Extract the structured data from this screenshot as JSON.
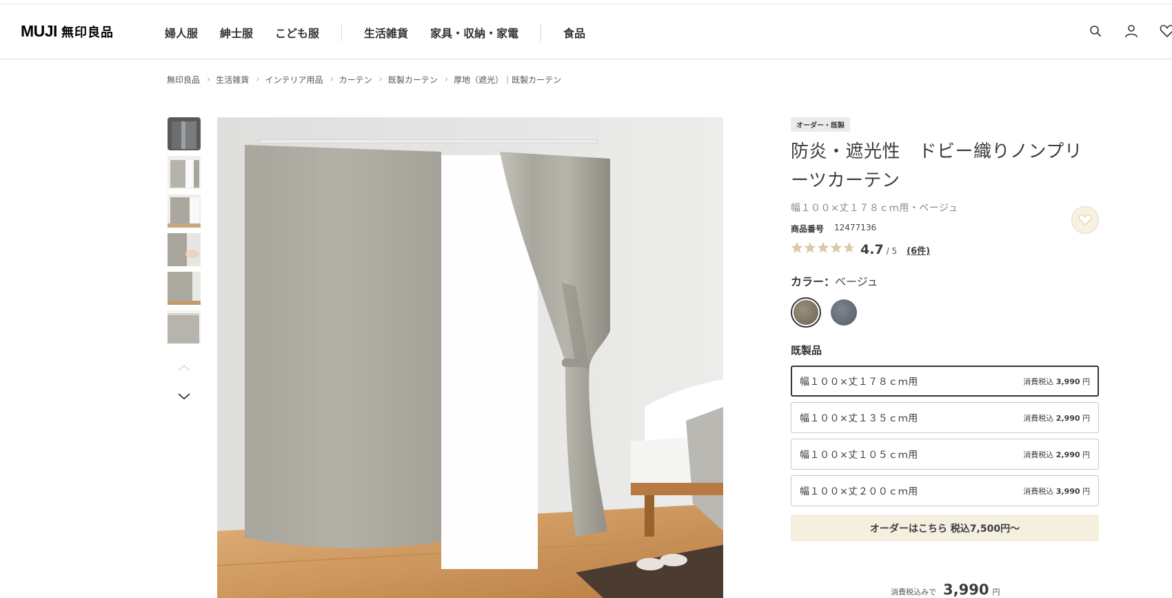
{
  "header": {
    "logo_en": "MUJI",
    "logo_jp": "無印良品",
    "nav_group1": [
      "婦人服",
      "紳士服",
      "こども服"
    ],
    "nav_group2": [
      "生活雑貨",
      "家具・収納・家電"
    ],
    "nav_group3": [
      "食品"
    ],
    "icons": [
      "search-icon",
      "user-icon",
      "heart-icon"
    ]
  },
  "breadcrumb": [
    "無印良品",
    "生活雑貨",
    "インテリア用品",
    "カーテン",
    "既製カーテン",
    "厚地（遮光）｜既製カーテン"
  ],
  "gallery": {
    "thumb_count": 6,
    "selected_index": 0
  },
  "product": {
    "tag": "オーダー・既製",
    "title": "防炎・遮光性　ドビー織りノンプリーツカーテン",
    "variant": "幅１００×丈１７８ｃｍ用・ベージュ",
    "code_label": "商品番号",
    "code": "12477136",
    "rating": "4.7",
    "rating_max": "/ 5",
    "review_count": "(6件)",
    "color_label": "カラー：",
    "color_value": "ベージュ",
    "colors": [
      {
        "name": "beige",
        "hex": "#857a68",
        "selected": true
      },
      {
        "name": "gray",
        "hex": "#686f7a",
        "selected": false
      }
    ],
    "section_label": "既製品",
    "options": [
      {
        "size": "幅１００×丈１７８ｃｍ用",
        "price_label": "消費税込",
        "price": "3,990",
        "unit": "円",
        "selected": true
      },
      {
        "size": "幅１００×丈１３５ｃｍ用",
        "price_label": "消費税込",
        "price": "2,990",
        "unit": "円",
        "selected": false
      },
      {
        "size": "幅１００×丈１０５ｃｍ用",
        "price_label": "消費税込",
        "price": "2,990",
        "unit": "円",
        "selected": false
      },
      {
        "size": "幅１００×丈２００ｃｍ用",
        "price_label": "消費税込",
        "price": "3,990",
        "unit": "円",
        "selected": false
      }
    ],
    "order_button": "オーダーはこちら 税込7,500円〜",
    "total_label": "消費税込みで",
    "total_price": "3,990",
    "total_unit": "円"
  },
  "colors": {
    "accent_beige": "#f5efe0",
    "star": "#d9c9a8",
    "text": "#3c3c3c"
  }
}
